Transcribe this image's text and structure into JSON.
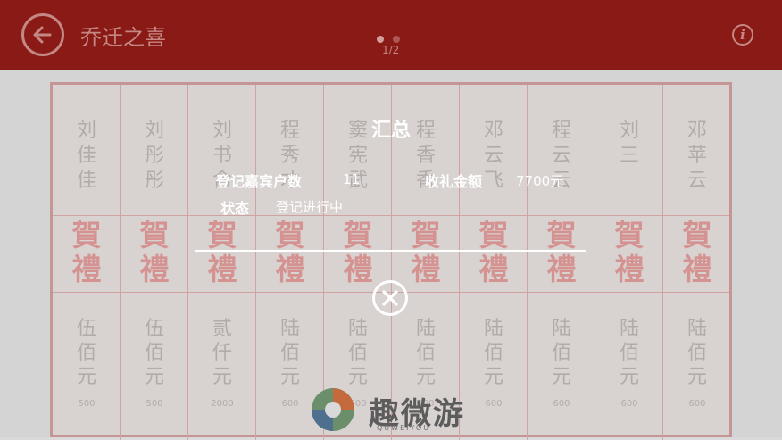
{
  "header": {
    "title": "乔迁之喜",
    "page_indicator": "1/2",
    "back_icon": "back-arrow-icon",
    "info_icon": "info-icon",
    "info_glyph": "i"
  },
  "ledger": {
    "columns": [
      {
        "name": [
          "刘",
          "佳",
          "佳"
        ],
        "gift": [
          "賀",
          "禮"
        ],
        "amount": [
          "伍",
          "佰",
          "元"
        ],
        "number": "500"
      },
      {
        "name": [
          "刘",
          "彤",
          "彤"
        ],
        "gift": [
          "賀",
          "禮"
        ],
        "amount": [
          "伍",
          "佰",
          "元"
        ],
        "number": "500"
      },
      {
        "name": [
          "刘",
          "书",
          "含"
        ],
        "gift": [
          "賀",
          "禮"
        ],
        "amount": [
          "贰",
          "仟",
          "元"
        ],
        "number": "2000"
      },
      {
        "name": [
          "程",
          "秀",
          "才"
        ],
        "gift": [
          "賀",
          "禮"
        ],
        "amount": [
          "陆",
          "佰",
          "元"
        ],
        "number": "600"
      },
      {
        "name": [
          "窦",
          "宪",
          "武"
        ],
        "gift": [
          "賀",
          "禮"
        ],
        "amount": [
          "陆",
          "佰",
          "元"
        ],
        "number": "600"
      },
      {
        "name": [
          "程",
          "香",
          "香"
        ],
        "gift": [
          "賀",
          "禮"
        ],
        "amount": [
          "陆",
          "佰",
          "元"
        ],
        "number": "600"
      },
      {
        "name": [
          "邓",
          "云",
          "飞"
        ],
        "gift": [
          "賀",
          "禮"
        ],
        "amount": [
          "陆",
          "佰",
          "元"
        ],
        "number": "600"
      },
      {
        "name": [
          "程",
          "云",
          "云"
        ],
        "gift": [
          "賀",
          "禮"
        ],
        "amount": [
          "陆",
          "佰",
          "元"
        ],
        "number": "600"
      },
      {
        "name": [
          "刘",
          "三"
        ],
        "gift": [
          "賀",
          "禮"
        ],
        "amount": [
          "陆",
          "佰",
          "元"
        ],
        "number": "600"
      },
      {
        "name": [
          "邓",
          "苹",
          "云"
        ],
        "gift": [
          "賀",
          "禮"
        ],
        "amount": [
          "陆",
          "佰",
          "元"
        ],
        "number": "600"
      }
    ]
  },
  "summary": {
    "title": "汇总",
    "guest_count_label": "登记嘉宾户数",
    "guest_count_value": "11",
    "total_amount_label": "收礼金额",
    "total_amount_value": "7700元",
    "status_label": "状态",
    "status_value": "登记进行中",
    "close_icon": "close-circle-icon"
  },
  "watermark": {
    "text": "趣微游",
    "sub": "QUWEIYOU"
  },
  "colors": {
    "header_bg": "#8c1b17",
    "gift_red": "#d99593"
  }
}
